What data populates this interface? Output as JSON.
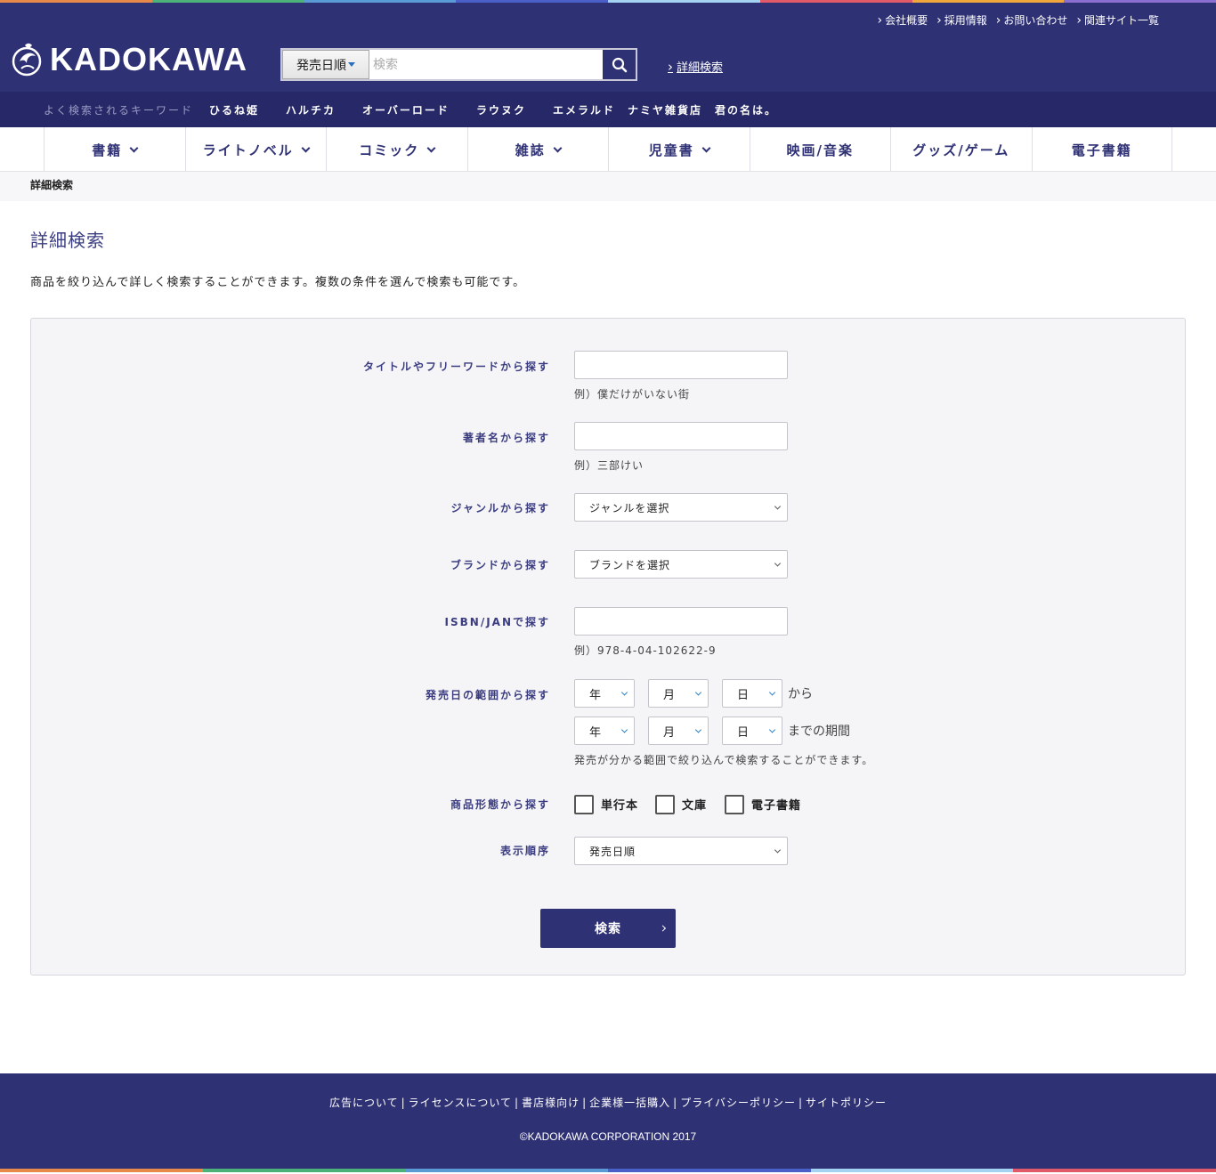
{
  "colors": {
    "brand": "#2f3175",
    "stripe": [
      "#e7894a",
      "#4db27a",
      "#5b9bd5",
      "#4a5fc7",
      "#a3d3f0",
      "#e05a6a",
      "#f0a63b",
      "#8a6fd1"
    ]
  },
  "header": {
    "util_links": [
      "会社概要",
      "採用情報",
      "お問い合わせ",
      "関連サイト一覧"
    ],
    "logo_text": "KADOKAWA",
    "search": {
      "sort_label": "発売日順",
      "placeholder": "検索",
      "value": ""
    },
    "advanced_link": "詳細検索",
    "keywords_label": "よく検索されるキーワード",
    "keywords": [
      "ひるね姫",
      "ハルチカ",
      "オーバーロード",
      "ラウヌク",
      "エメラルド",
      "ナミヤ雑貨店",
      "君の名は。"
    ]
  },
  "nav": {
    "items": [
      "書籍",
      "ライトノベル",
      "コミック",
      "雑誌",
      "児童書",
      "映画/音楽",
      "グッズ/ゲーム",
      "電子書籍"
    ]
  },
  "breadcrumb": "詳細検索",
  "main": {
    "title": "詳細検索",
    "description": "商品を絞り込んで詳しく検索することができます。複数の条件を選んで検索も可能です。"
  },
  "form": {
    "title_label": "タイトルやフリーワードから探す",
    "title_hint": "例）僕だけがいない街",
    "author_label": "著者名から探す",
    "author_hint": "例）三部けい",
    "genre_label": "ジャンルから探す",
    "genre_value": "ジャンルを選択",
    "brand_label": "ブランドから探す",
    "brand_value": "ブランドを選択",
    "isbn_label": "ISBN/JANで探す",
    "isbn_hint": "例）978-4-04-102622-9",
    "date_label": "発売日の範囲から探す",
    "date_year": "年",
    "date_month": "月",
    "date_day": "日",
    "date_from_suffix": "から",
    "date_to_suffix": "までの期間",
    "date_hint": "発売が分かる範囲で絞り込んで検索することができます。",
    "format_label": "商品形態から探す",
    "format_options": [
      "単行本",
      "文庫",
      "電子書籍"
    ],
    "order_label": "表示順序",
    "order_value": "発売日順",
    "submit_label": "検索"
  },
  "footer": {
    "links": [
      "広告について",
      "ライセンスについて",
      "書店様向け",
      "企業様一括購入",
      "プライバシーポリシー",
      "サイトポリシー"
    ],
    "copyright": "©KADOKAWA CORPORATION 2017"
  }
}
